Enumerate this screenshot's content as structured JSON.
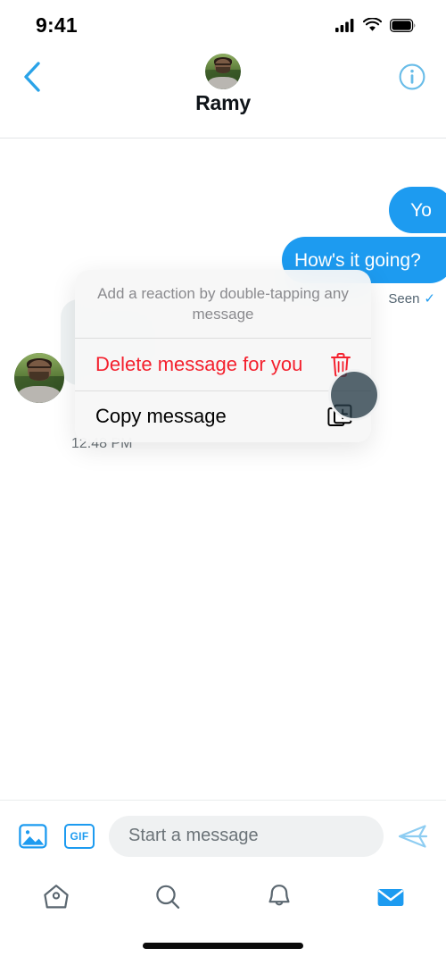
{
  "status_bar": {
    "time": "9:41",
    "cellular_icon": "cellular-signal-icon",
    "wifi_icon": "wifi-icon",
    "battery_icon": "battery-full-icon"
  },
  "header": {
    "back_icon": "back-chevron-icon",
    "info_icon": "info-circle-icon",
    "avatar": "contact-avatar",
    "title": "Ramy",
    "accent_color": "#1d9bf0",
    "info_color": "#68bce8"
  },
  "conversation": {
    "messages": [
      {
        "id": "yo",
        "text": "Yo",
        "direction": "outgoing",
        "color": "#1d9bf0"
      },
      {
        "id": "how",
        "text": "How's it going?",
        "direction": "outgoing",
        "color": "#1d9bf0"
      },
      {
        "id": "incoming",
        "text": "",
        "direction": "incoming",
        "color": "#eff3f4"
      }
    ],
    "seen_label": "Seen",
    "seen_check": "✓",
    "timestamp": "12:48 PM"
  },
  "context_menu": {
    "header_text": "Add a reaction by double-tapping any message",
    "items": [
      {
        "label": "Delete message for you",
        "icon": "trash-icon",
        "style": "destructive",
        "color": "#f4212e"
      },
      {
        "label": "Copy message",
        "icon": "copy-icon",
        "style": "normal",
        "color": "#000000"
      }
    ]
  },
  "touch_indicator": {
    "name": "touch-press-indicator",
    "color": "rgba(40,60,72,0.78)"
  },
  "composer": {
    "photo_icon": "photo-icon",
    "gif_icon": "gif-icon",
    "gif_label": "GIF",
    "placeholder": "Start a message",
    "value": "",
    "send_icon": "send-arrow-icon"
  },
  "tab_bar": {
    "tabs": [
      {
        "name": "home",
        "icon": "home-icon",
        "active": false
      },
      {
        "name": "search",
        "icon": "search-icon",
        "active": false
      },
      {
        "name": "notifications",
        "icon": "bell-icon",
        "active": false
      },
      {
        "name": "messages",
        "icon": "envelope-icon",
        "active": true
      }
    ],
    "active_color": "#1d9bf0",
    "inactive_color": "#5b6770"
  }
}
